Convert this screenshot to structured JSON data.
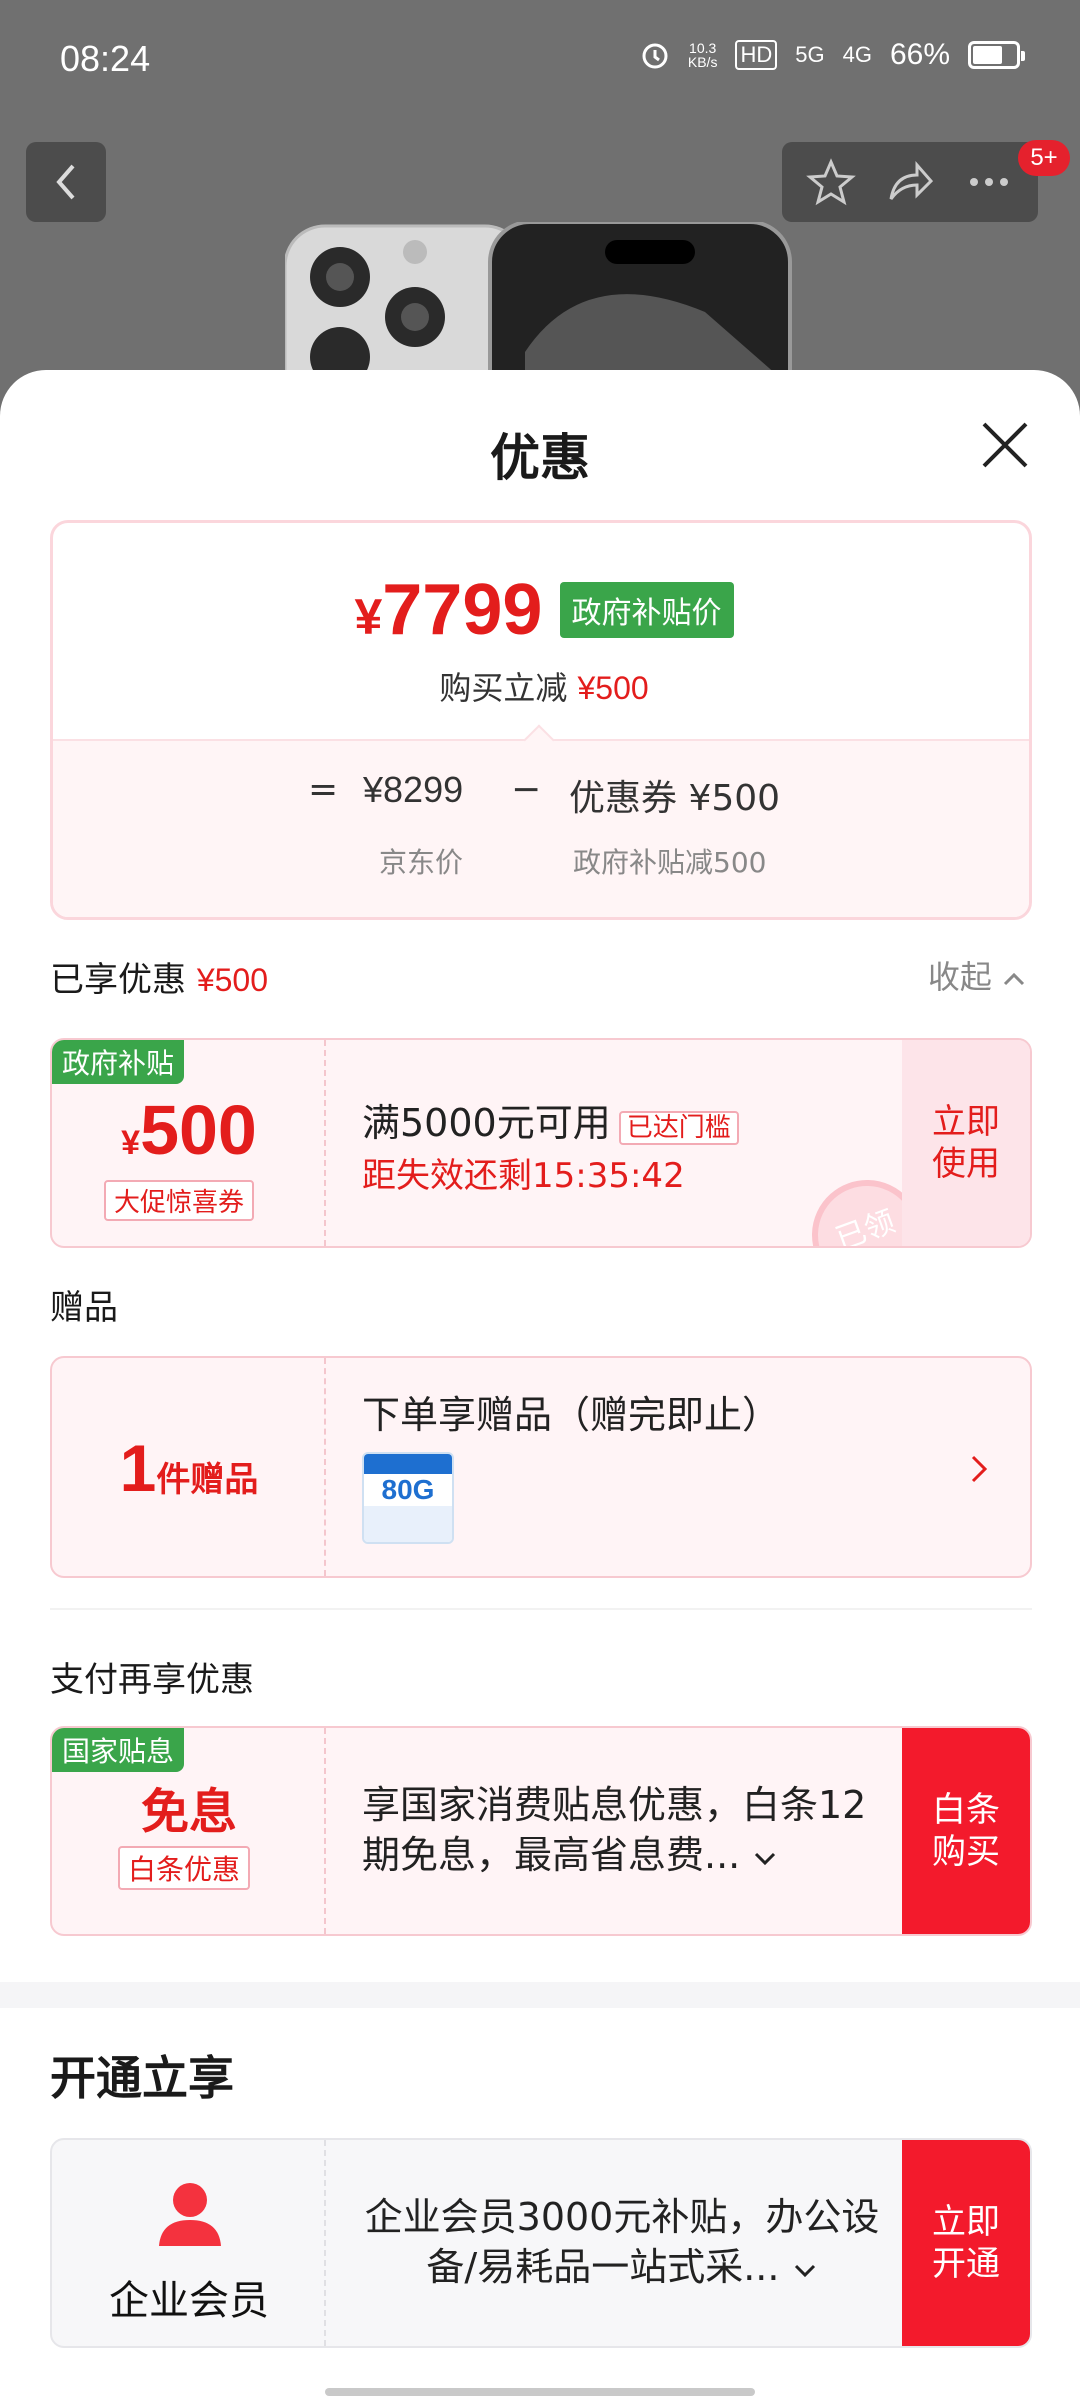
{
  "status_bar": {
    "time": "08:24",
    "net_speed_top": "10.3",
    "net_speed_bottom": "KB/s",
    "hd": "HD",
    "sig1": "5G",
    "sig2": "4G",
    "battery": "66%"
  },
  "nav": {
    "badge": "5+"
  },
  "sheet": {
    "title": "优惠",
    "price": {
      "yen": "¥",
      "amount": "7799",
      "tag": "政府补贴价",
      "sub_label": "购买立减",
      "sub_amount": "¥500",
      "eq": "=",
      "jd_price": "¥8299",
      "minus": "−",
      "coupon": "优惠券 ¥500",
      "jd_label": "京东价",
      "coupon_label": "政府补贴减500"
    },
    "enjoyed": {
      "label": "已享优惠",
      "amount": "¥500",
      "collapse": "收起"
    },
    "coupon1": {
      "tag": "政府补贴",
      "yen": "¥",
      "amount": "500",
      "badge": "大促惊喜券",
      "condition": "满5000元可用",
      "reached": "已达门槛",
      "timer": "距失效还剩15:35:42",
      "stamp": "已领",
      "action": "立即\n使用"
    },
    "gift": {
      "header": "赠品",
      "count": "1",
      "count_label": "件赠品",
      "title": "下单享赠品（赠完即止）",
      "thumb_text": "80G"
    },
    "pay": {
      "header": "支付再享优惠",
      "tag": "国家贴息",
      "free": "免息",
      "badge": "白条优惠",
      "desc": "享国家消费贴息优惠，白条12期免息，最高省息费...",
      "action": "白条\n购买"
    },
    "open": {
      "header": "开通立享",
      "member": "企业会员",
      "desc": "企业会员3000元补贴，办公设备/易耗品一站式采...",
      "action": "立即\n开通"
    }
  }
}
